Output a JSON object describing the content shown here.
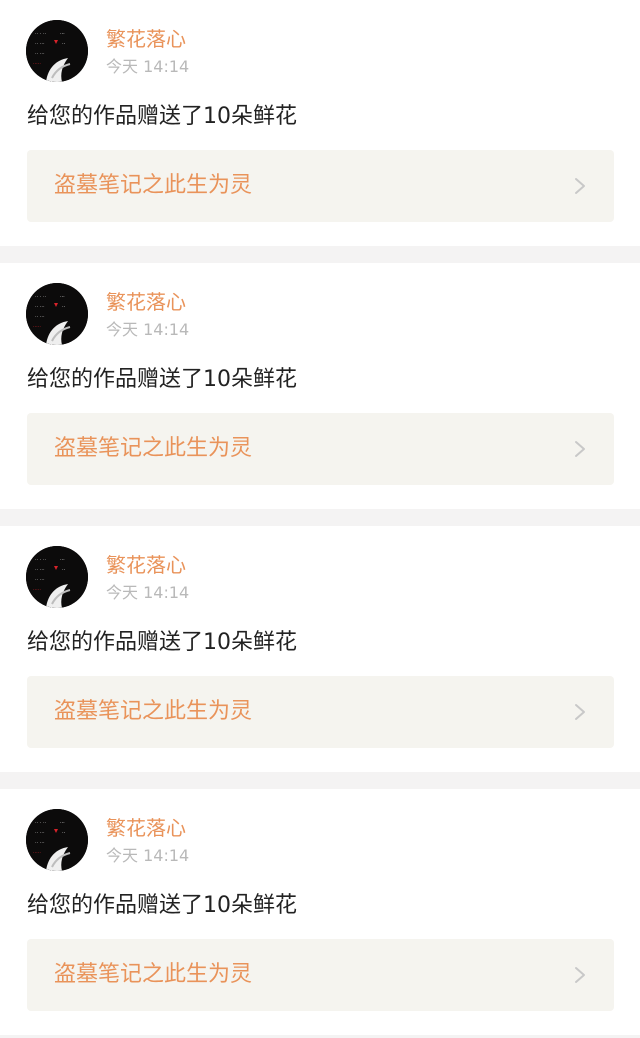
{
  "notifications": [
    {
      "user_name": "繁花落心",
      "time": "今天 14:14",
      "message": "给您的作品赠送了10朵鲜花",
      "work_title": "盗墓笔记之此生为灵",
      "avatar_icon": "user-avatar-icon"
    },
    {
      "user_name": "繁花落心",
      "time": "今天 14:14",
      "message": "给您的作品赠送了10朵鲜花",
      "work_title": "盗墓笔记之此生为灵",
      "avatar_icon": "user-avatar-icon"
    },
    {
      "user_name": "繁花落心",
      "time": "今天 14:14",
      "message": "给您的作品赠送了10朵鲜花",
      "work_title": "盗墓笔记之此生为灵",
      "avatar_icon": "user-avatar-icon"
    },
    {
      "user_name": "繁花落心",
      "time": "今天 14:14",
      "message": "给您的作品赠送了10朵鲜花",
      "work_title": "盗墓笔记之此生为灵",
      "avatar_icon": "user-avatar-icon"
    }
  ],
  "colors": {
    "accent": "#e9935a",
    "background": "#f4f3f3",
    "card": "#ffffff",
    "link_box": "#f5f4ef",
    "muted_text": "#b9b9b9",
    "body_text": "#222222"
  },
  "icons": {
    "chevron": "chevron-right-icon"
  }
}
